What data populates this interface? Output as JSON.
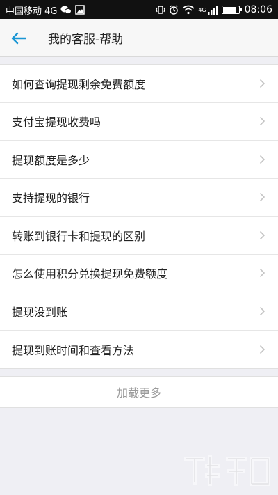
{
  "status_bar": {
    "carrier": "中国移动 4G",
    "network_badge": "4G",
    "time": "08:06"
  },
  "header": {
    "title": "我的客服-帮助"
  },
  "faq": {
    "items": [
      {
        "label": "如何查询提现剩余免费额度"
      },
      {
        "label": "支付宝提现收费吗"
      },
      {
        "label": "提现额度是多少"
      },
      {
        "label": "支持提现的银行"
      },
      {
        "label": "转账到银行卡和提现的区别"
      },
      {
        "label": "怎么使用积分兑换提现免费额度"
      },
      {
        "label": "提现没到账"
      },
      {
        "label": "提现到账时间和查看方法"
      }
    ]
  },
  "load_more": {
    "label": "加载更多"
  },
  "colors": {
    "accent": "#1a96d4",
    "chevron": "#c4c4c4",
    "muted_text": "#9a9a9a"
  },
  "icons": {
    "back": "arrow-left-icon",
    "chevron": "chevron-right-icon"
  }
}
